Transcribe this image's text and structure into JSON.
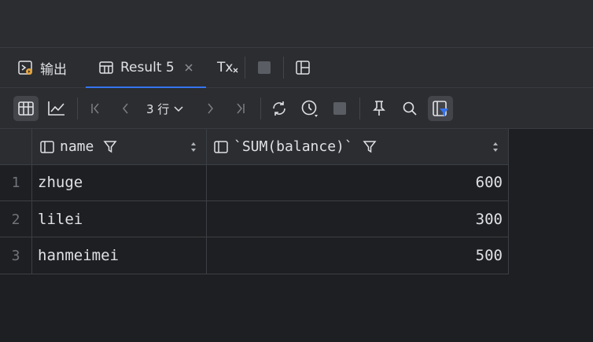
{
  "tabs": [
    {
      "label": "输出",
      "icon": "run-output-icon"
    },
    {
      "label": "Result 5",
      "icon": "table-icon",
      "active": true
    },
    {
      "label": "Tx",
      "icon": "transaction-icon"
    }
  ],
  "toolbar": {
    "pager_label": "3 行",
    "items": [
      "table-view",
      "chart-view",
      "first-page",
      "previous-page",
      "next-page",
      "last-page",
      "reload",
      "history",
      "stop",
      "pin",
      "search",
      "filter-toggle"
    ]
  },
  "table": {
    "columns": [
      {
        "name": "name",
        "align": "left"
      },
      {
        "name": "`SUM(balance)`",
        "align": "right"
      }
    ],
    "rows": [
      {
        "num": "1",
        "name": "zhuge",
        "sum": "600"
      },
      {
        "num": "2",
        "name": "lilei",
        "sum": "300"
      },
      {
        "num": "3",
        "name": "hanmeimei",
        "sum": "500"
      }
    ]
  },
  "colors": {
    "bg": "#1e1f22",
    "panel": "#2b2d30",
    "accent": "#3574f0"
  }
}
